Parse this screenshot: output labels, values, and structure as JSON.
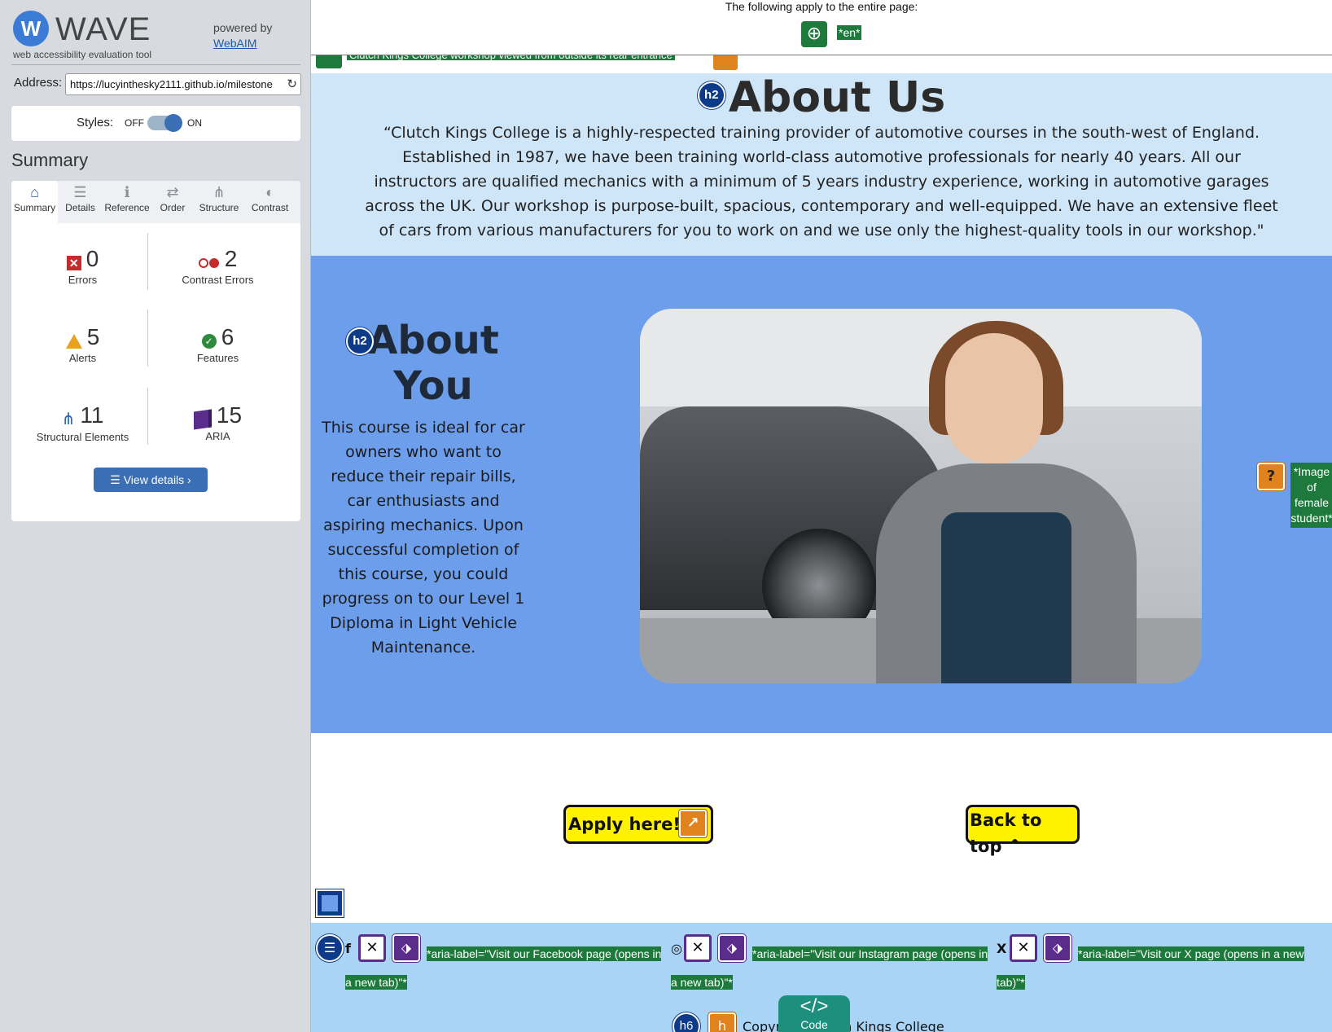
{
  "wave": {
    "logo_letter": "W",
    "logo_word": "WAVE",
    "tagline": "web accessibility evaluation tool",
    "powered_by": "powered by",
    "webaim_link": "WebAIM",
    "address_label": "Address:",
    "address_value": "https://lucyinthesky2111.github.io/milestone",
    "styles_label": "Styles:",
    "styles_off": "OFF",
    "styles_on": "ON",
    "summary_heading": "Summary",
    "tabs": [
      {
        "label": "Summary",
        "icon": "home-icon",
        "glyph": "⌂",
        "active": true
      },
      {
        "label": "Details",
        "icon": "list-icon",
        "glyph": "☰",
        "active": false
      },
      {
        "label": "Reference",
        "icon": "info-icon",
        "glyph": "ℹ",
        "active": false
      },
      {
        "label": "Order",
        "icon": "order-icon",
        "glyph": "⇄",
        "active": false
      },
      {
        "label": "Structure",
        "icon": "structure-icon",
        "glyph": "⋔",
        "active": false
      },
      {
        "label": "Contrast",
        "icon": "contrast-icon",
        "glyph": "◐",
        "active": false
      }
    ],
    "stats": {
      "errors": {
        "value": "0",
        "label": "Errors"
      },
      "contrast_errors": {
        "value": "2",
        "label": "Contrast Errors"
      },
      "alerts": {
        "value": "5",
        "label": "Alerts"
      },
      "features": {
        "value": "6",
        "label": "Features"
      },
      "structural": {
        "value": "11",
        "label": "Structural Elements"
      },
      "aria": {
        "value": "15",
        "label": "ARIA"
      }
    },
    "view_details": "View details ›"
  },
  "page": {
    "global_notice": "The following apply to the entire page:",
    "lang_tag": "*en*",
    "clipped_alt": "Clutch Kings College workshop viewed from outside its rear entrance",
    "about_us": {
      "badge": "h2",
      "title": "About Us",
      "text": "“Clutch Kings College is a highly-respected training provider of automotive courses in the south-west of England. Established in 1987, we have been training world-class automotive professionals for nearly 40 years. All our instructors are qualified mechanics with a minimum of 5 years industry experience, working in automotive garages across the UK. Our workshop is purpose-built, spacious, contemporary and well-equipped. We have an extensive fleet of cars from various manufacturers for you to work on and we use only the highest-quality tools in our workshop.\""
    },
    "about_you": {
      "badge": "h2",
      "title": "About You",
      "text": "This course is ideal for car owners who want to reduce their repair bills, car enthusiasts and aspiring mechanics. Upon successful completion of this course, you could progress on to our Level 1 Diploma in Light Vehicle Maintenance.",
      "image_alert": "?",
      "image_alt": "*Image of female student*"
    },
    "apply_button": "Apply here! >",
    "back_to_top": "Back to top ^",
    "footer": {
      "list_badge": "☰",
      "facebook": {
        "icon": "facebook-icon",
        "glyph": "f",
        "aria": "*aria-label=\"Visit our Facebook page (opens in a new tab)\"*"
      },
      "instagram": {
        "icon": "instagram-icon",
        "glyph": "◎",
        "aria": "*aria-label=\"Visit our Instagram page (opens in a new tab)\"*"
      },
      "x": {
        "icon": "x-icon",
        "glyph": "X",
        "aria": "*aria-label=\"Visit our X page (opens in a new tab)\"*"
      },
      "h6_badge": "h6",
      "h_alert": "h",
      "copyright": "Copyright Clutch Kings College"
    },
    "code_toggle": {
      "icon": "</>",
      "label": "Code"
    }
  }
}
